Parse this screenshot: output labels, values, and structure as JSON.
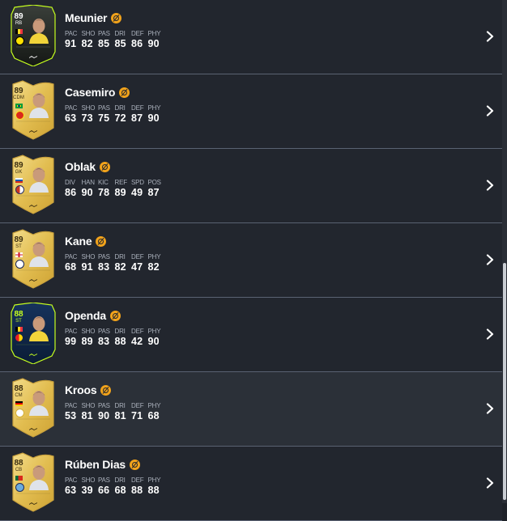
{
  "players": [
    {
      "name": "Meunier",
      "rating": "89",
      "position": "RB",
      "card_style": "dark",
      "nation_flag": "belgium-flag-icon",
      "club_badge": "dortmund-badge-icon",
      "stat_labels": [
        "PAC",
        "SHO",
        "PAS",
        "DRI",
        "DEF",
        "PHY"
      ],
      "stat_values": [
        "91",
        "82",
        "85",
        "85",
        "86",
        "90"
      ]
    },
    {
      "name": "Casemiro",
      "rating": "89",
      "position": "CDM",
      "card_style": "gold",
      "nation_flag": "brazil-flag-icon",
      "club_badge": "manchester-united-badge-icon",
      "stat_labels": [
        "PAC",
        "SHO",
        "PAS",
        "DRI",
        "DEF",
        "PHY"
      ],
      "stat_values": [
        "63",
        "73",
        "75",
        "72",
        "87",
        "90"
      ]
    },
    {
      "name": "Oblak",
      "rating": "89",
      "position": "GK",
      "card_style": "gold",
      "nation_flag": "slovenia-flag-icon",
      "club_badge": "atletico-madrid-badge-icon",
      "stat_labels": [
        "DIV",
        "HAN",
        "KIC",
        "REF",
        "SPD",
        "POS"
      ],
      "stat_values": [
        "86",
        "90",
        "78",
        "89",
        "49",
        "87"
      ]
    },
    {
      "name": "Kane",
      "rating": "89",
      "position": "ST",
      "card_style": "gold",
      "nation_flag": "england-flag-icon",
      "club_badge": "tottenham-badge-icon",
      "stat_labels": [
        "PAC",
        "SHO",
        "PAS",
        "DRI",
        "DEF",
        "PHY"
      ],
      "stat_values": [
        "68",
        "91",
        "83",
        "82",
        "47",
        "82"
      ]
    },
    {
      "name": "Openda",
      "rating": "88",
      "position": "ST",
      "card_style": "navy",
      "nation_flag": "belgium-flag-icon",
      "club_badge": "lens-badge-icon",
      "stat_labels": [
        "PAC",
        "SHO",
        "PAS",
        "DRI",
        "DEF",
        "PHY"
      ],
      "stat_values": [
        "99",
        "89",
        "83",
        "88",
        "42",
        "90"
      ]
    },
    {
      "name": "Kroos",
      "rating": "88",
      "position": "CM",
      "card_style": "gold",
      "nation_flag": "germany-flag-icon",
      "club_badge": "real-madrid-badge-icon",
      "stat_labels": [
        "PAC",
        "SHO",
        "PAS",
        "DRI",
        "DEF",
        "PHY"
      ],
      "stat_values": [
        "53",
        "81",
        "90",
        "81",
        "71",
        "68"
      ]
    },
    {
      "name": "Rúben Dias",
      "rating": "88",
      "position": "CB",
      "card_style": "gold",
      "nation_flag": "portugal-flag-icon",
      "club_badge": "manchester-city-badge-icon",
      "stat_labels": [
        "PAC",
        "SHO",
        "PAS",
        "DRI",
        "DEF",
        "PHY"
      ],
      "stat_values": [
        "63",
        "39",
        "66",
        "68",
        "88",
        "88"
      ]
    }
  ],
  "icons": {
    "chemistry": "chemistry-icon",
    "row_action": "chevron-right-icon"
  },
  "colors": {
    "background": "#22262e",
    "highlight_row": "#2b3038",
    "divider": "#5a6272",
    "gold_card": "#e8c55a",
    "chemistry": "#f2a31b"
  }
}
